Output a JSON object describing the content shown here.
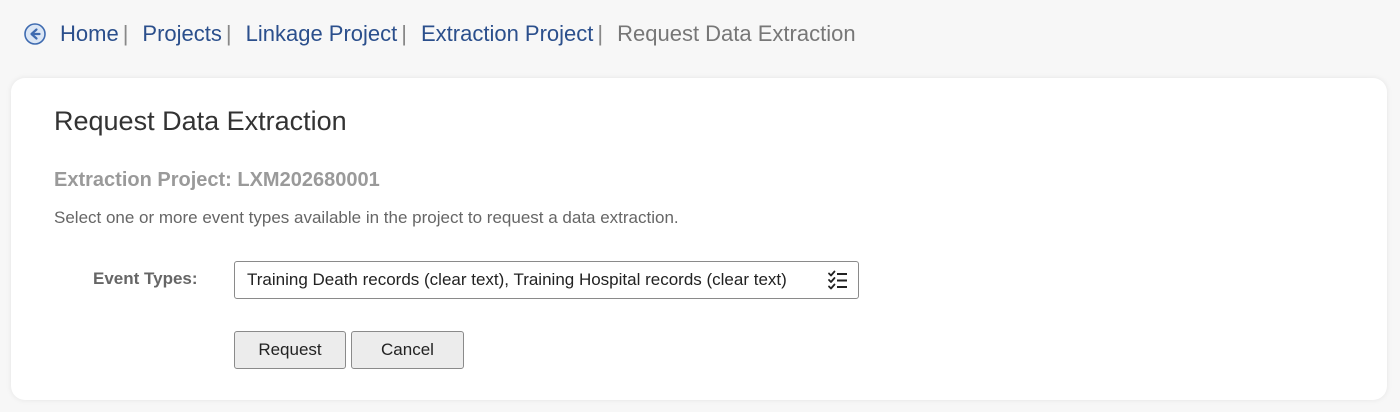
{
  "breadcrumb": {
    "back_icon": "back-arrow-circle-icon",
    "items": [
      {
        "label": "Home"
      },
      {
        "label": "Projects"
      },
      {
        "label": "Linkage Project"
      },
      {
        "label": "Extraction Project"
      }
    ],
    "separator": "|",
    "current": "Request Data Extraction"
  },
  "main": {
    "title": "Request Data Extraction",
    "project_line": "Extraction Project: LXM202680001",
    "instructions": "Select one or more event types available in the project to request a data extraction.",
    "event_types": {
      "label": "Event Types:",
      "value": "Training Death records (clear text), Training Hospital records (clear text)",
      "icon": "checklist-icon"
    },
    "buttons": {
      "request": "Request",
      "cancel": "Cancel"
    }
  },
  "colors": {
    "link": "#2b4f8c",
    "back_icon": "#3f6bb0",
    "muted_heading": "#9a9a9a",
    "page_bg": "#f7f7f7",
    "card_bg": "#ffffff",
    "button_bg": "#ececec"
  }
}
